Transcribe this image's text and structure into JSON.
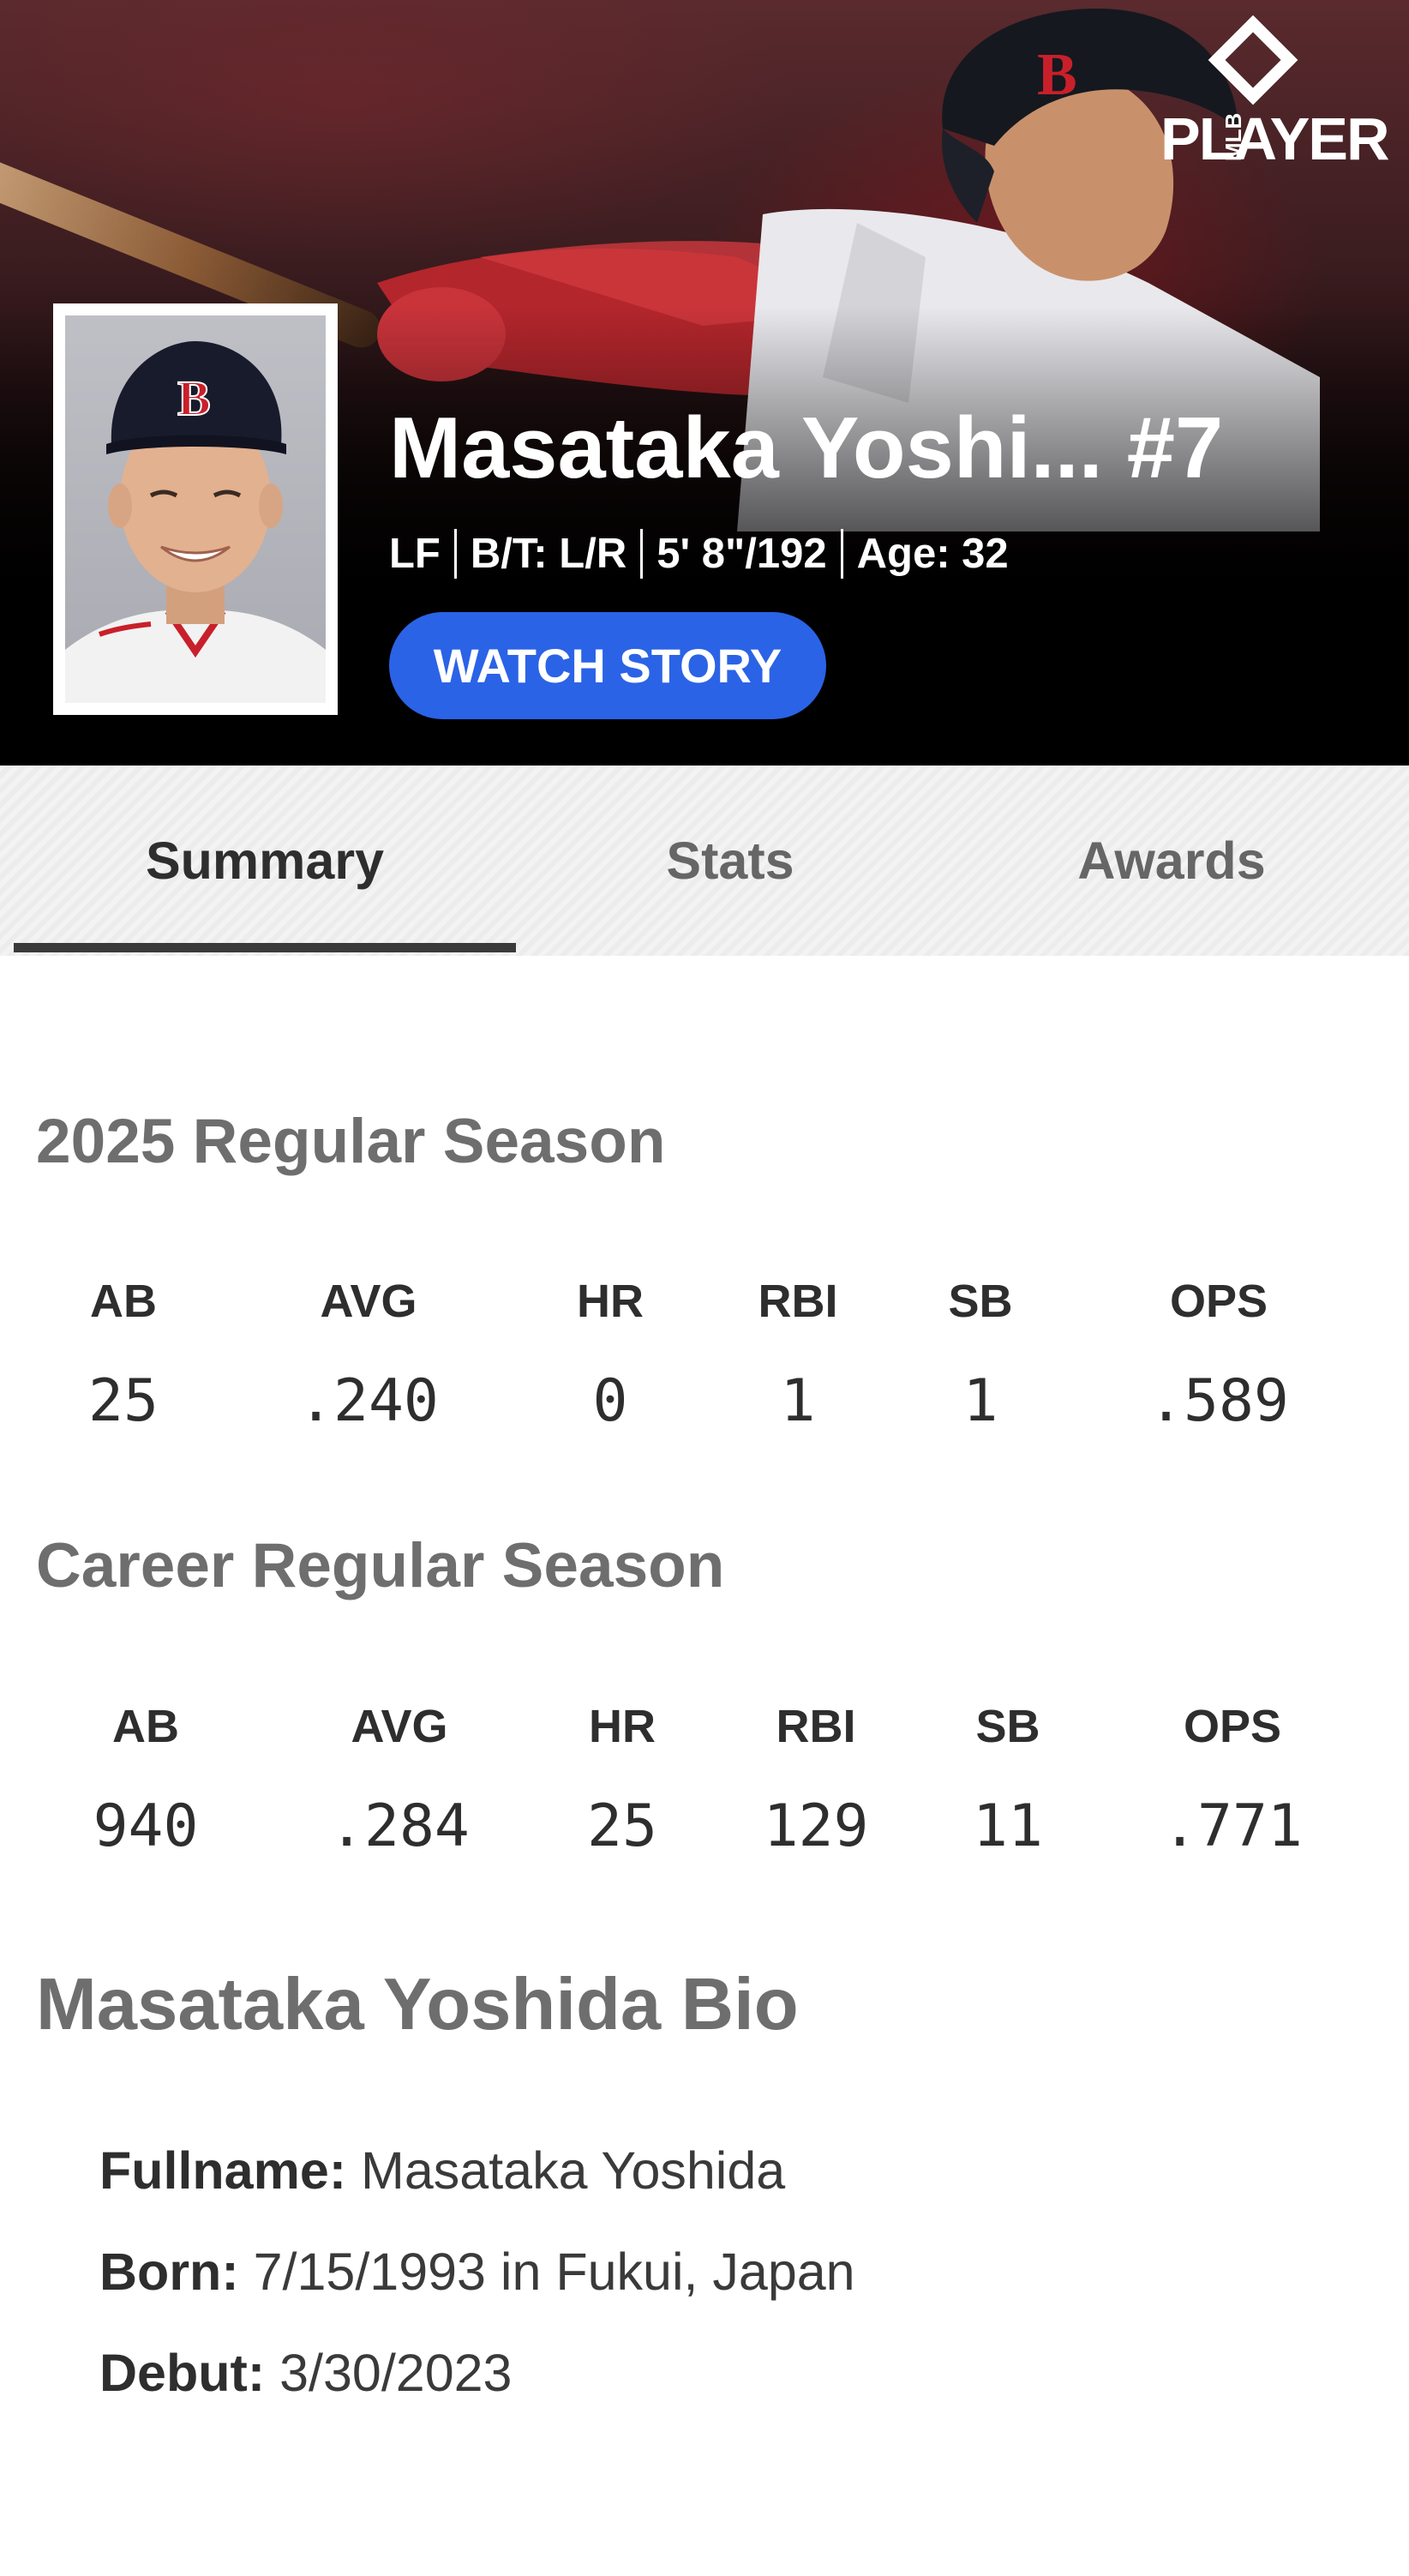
{
  "hero": {
    "logo_text": "PLAYERS",
    "logo_sub": "MLB",
    "player_name": "Masataka Yoshi... #7",
    "meta": {
      "position": "LF",
      "bats_throws": "B/T: L/R",
      "height_weight": "5' 8\"/192",
      "age": "Age: 32"
    },
    "watch_button": "WATCH STORY",
    "cap_letter": "B"
  },
  "tabs": [
    {
      "label": "Summary",
      "active": true
    },
    {
      "label": "Stats",
      "active": false
    },
    {
      "label": "Awards",
      "active": false
    }
  ],
  "season": {
    "title": "2025 Regular Season",
    "stats": [
      {
        "label": "AB",
        "value": "25"
      },
      {
        "label": "AVG",
        "value": ".240"
      },
      {
        "label": "HR",
        "value": "0"
      },
      {
        "label": "RBI",
        "value": "1"
      },
      {
        "label": "SB",
        "value": "1"
      },
      {
        "label": "OPS",
        "value": ".589"
      }
    ]
  },
  "career": {
    "title": "Career Regular Season",
    "stats": [
      {
        "label": "AB",
        "value": "940"
      },
      {
        "label": "AVG",
        "value": ".284"
      },
      {
        "label": "HR",
        "value": "25"
      },
      {
        "label": "RBI",
        "value": "129"
      },
      {
        "label": "SB",
        "value": "11"
      },
      {
        "label": "OPS",
        "value": ".771"
      }
    ]
  },
  "bio": {
    "title": "Masataka Yoshida Bio",
    "fullname_label": "Fullname:",
    "fullname": "Masataka Yoshida",
    "born_label": "Born:",
    "born": "7/15/1993 in Fukui, Japan",
    "debut_label": "Debut:",
    "debut": "3/30/2023"
  },
  "colors": {
    "accent": "#2b63e6",
    "tab_underline": "#3a3a3a",
    "heading_gray": "#6e6e6e"
  }
}
